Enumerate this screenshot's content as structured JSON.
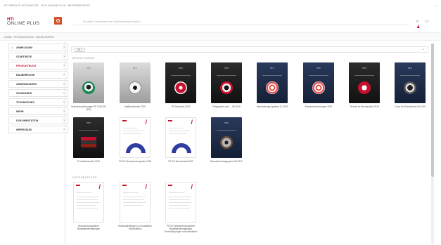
{
  "window": {
    "top_title": "HTI SERVICE ACCOUNT DE · HILTI ONLINE PLUS · BETRIEBSKONTO",
    "top_right_icon": "dash-icon"
  },
  "header": {
    "logo_line1": "HTI",
    "logo_line2": "ONLINE PLUS",
    "search_placeholder": "Produkte, Dokumente oder Artikelnummern suchen",
    "icons": [
      "search-icon",
      "cart-icon",
      "user-icon"
    ]
  },
  "breadcrumb": "HOME  ›  PRODUKTBOOK  ›  BROSCHÜREN",
  "sidebar": {
    "items": [
      {
        "label": "ANMELDUNG",
        "active": false,
        "home": true
      },
      {
        "label": "STARTSEITE",
        "active": false
      },
      {
        "label": "PRODUKTBUCH",
        "active": true
      },
      {
        "label": "BAUBEREICHE",
        "active": false
      },
      {
        "label": "ANWENDUNGEN",
        "active": false
      },
      {
        "label": "STANDARDS",
        "active": false
      },
      {
        "label": "TECHNISCHES",
        "active": false
      },
      {
        "label": "MEHR",
        "active": false
      },
      {
        "label": "DOKUMENTATION",
        "active": false
      },
      {
        "label": "IMPRESSUM",
        "active": false
      }
    ]
  },
  "filter": {
    "chip": "DE ×",
    "dropdown_icon": "chevron-down-icon"
  },
  "sections": {
    "brochures": "BROSCHÜREN",
    "datasheets": "DATENBLÄTTER"
  },
  "brochures": [
    {
      "caption": "Brandschutzlösungen PP 2019-DE (DE)",
      "style": "gray",
      "product": "green"
    },
    {
      "caption": "Multifunktionale 2019",
      "style": "gray",
      "product": "white"
    },
    {
      "caption": "PP Übersicht 2019",
      "style": "black",
      "product": "redm"
    },
    {
      "caption": "Ringsystem und … 06.2019",
      "style": "black",
      "product": "redring"
    },
    {
      "caption": "Abschottungs-systeme 11.2019",
      "style": "navy",
      "product": "stripe"
    },
    {
      "caption": "Brandschutzlösungen 2019",
      "style": "navy",
      "product": "stripe"
    },
    {
      "caption": "Technik im Brandschutz 2019",
      "style": "black",
      "product": "redwhite"
    },
    {
      "caption": "Cover für Brandschutz 06.2019",
      "style": "navy",
      "product": "dark"
    },
    {
      "caption": "Produktübersicht 2019",
      "style": "black",
      "product": "box3"
    },
    {
      "caption": "FS-SC Brandschutzsystem 2019",
      "style": "doc",
      "product": "arch"
    },
    {
      "caption": "FS-SC Mehrschicht 2019",
      "style": "doc",
      "product": "arch"
    },
    {
      "caption": "Brandschutzringsystem 06.2019",
      "style": "navy",
      "product": "brownring"
    }
  ],
  "datasheets": [
    {
      "caption": "Brandschutzsysteme Bauartgenehmigungen"
    },
    {
      "caption": "Einbauanleitungen zur Installation Abschottung"
    },
    {
      "caption": "PP-SC Brandschutzsysteme Bauartgenehmigungen Durchdringungen und Installation"
    }
  ],
  "colors": {
    "accent": "#c8102e",
    "brand_square": "#d4502a"
  }
}
